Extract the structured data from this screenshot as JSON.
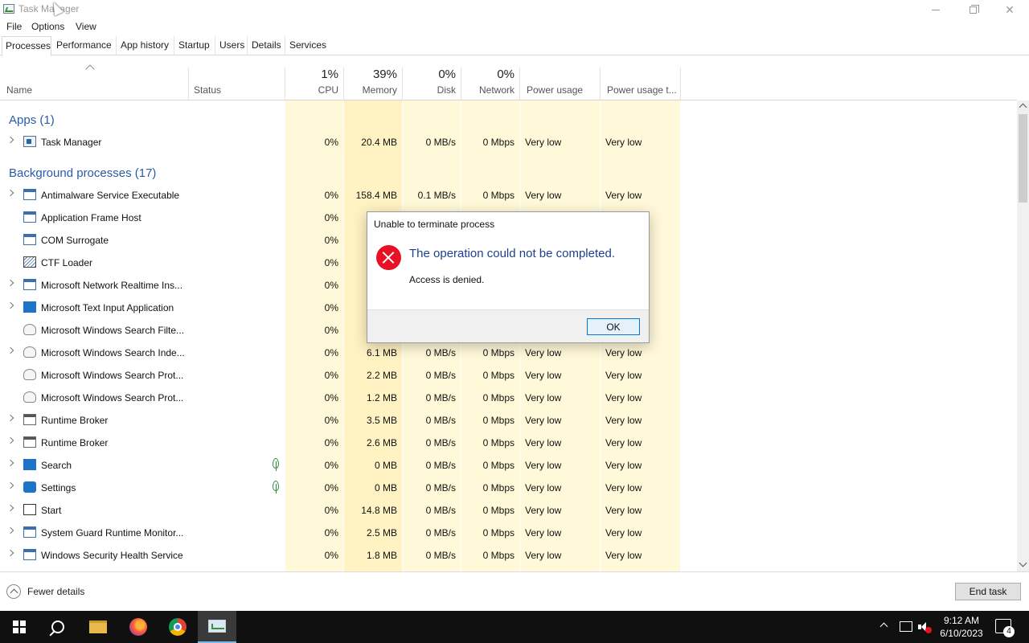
{
  "window": {
    "title": "Task Manager"
  },
  "menu": {
    "file": "File",
    "options": "Options",
    "view": "View"
  },
  "tabs": [
    "Processes",
    "Performance",
    "App history",
    "Startup",
    "Users",
    "Details",
    "Services"
  ],
  "columns": {
    "name": "Name",
    "status": "Status",
    "cpu": {
      "pct": "1%",
      "label": "CPU"
    },
    "memory": {
      "pct": "39%",
      "label": "Memory"
    },
    "disk": {
      "pct": "0%",
      "label": "Disk"
    },
    "network": {
      "pct": "0%",
      "label": "Network"
    },
    "power": "Power usage",
    "power_trend": "Power usage t..."
  },
  "groups": {
    "apps": "Apps (1)",
    "background": "Background processes (17)"
  },
  "processes": [
    {
      "name": "Task Manager",
      "icon": "task-manager-icon",
      "cpu": "0%",
      "mem": "20.4 MB",
      "disk": "0 MB/s",
      "net": "0 Mbps",
      "power": "Very low",
      "trend": "Very low"
    },
    {
      "name": "Antimalware Service Executable",
      "icon": "app-window-icon",
      "cpu": "0%",
      "mem": "158.4 MB",
      "disk": "0.1 MB/s",
      "net": "0 Mbps",
      "power": "Very low",
      "trend": "Very low"
    },
    {
      "name": "Application Frame Host",
      "icon": "app-window-icon",
      "cpu": "0%"
    },
    {
      "name": "COM Surrogate",
      "icon": "app-window-icon",
      "cpu": "0%"
    },
    {
      "name": "CTF Loader",
      "icon": "ctf-icon",
      "cpu": "0%"
    },
    {
      "name": "Microsoft Network Realtime Ins...",
      "icon": "app-window-icon",
      "cpu": "0%"
    },
    {
      "name": "Microsoft Text Input Application",
      "icon": "text-input-icon",
      "cpu": "0%"
    },
    {
      "name": "Microsoft Windows Search Filte...",
      "icon": "person-icon",
      "cpu": "0%"
    },
    {
      "name": "Microsoft Windows Search Inde...",
      "icon": "person-icon",
      "cpu": "0%",
      "mem": "6.1 MB",
      "disk": "0 MB/s",
      "net": "0 Mbps",
      "power": "Very low",
      "trend": "Very low"
    },
    {
      "name": "Microsoft Windows Search Prot...",
      "icon": "person-icon",
      "cpu": "0%",
      "mem": "2.2 MB",
      "disk": "0 MB/s",
      "net": "0 Mbps",
      "power": "Very low",
      "trend": "Very low"
    },
    {
      "name": "Microsoft Windows Search Prot...",
      "icon": "person-icon",
      "cpu": "0%",
      "mem": "1.2 MB",
      "disk": "0 MB/s",
      "net": "0 Mbps",
      "power": "Very low",
      "trend": "Very low"
    },
    {
      "name": "Runtime Broker",
      "icon": "gray-window-icon",
      "cpu": "0%",
      "mem": "3.5 MB",
      "disk": "0 MB/s",
      "net": "0 Mbps",
      "power": "Very low",
      "trend": "Very low"
    },
    {
      "name": "Runtime Broker",
      "icon": "gray-window-icon",
      "cpu": "0%",
      "mem": "2.6 MB",
      "disk": "0 MB/s",
      "net": "0 Mbps",
      "power": "Very low",
      "trend": "Very low"
    },
    {
      "name": "Search",
      "icon": "search-icon",
      "cpu": "0%",
      "mem": "0 MB",
      "disk": "0 MB/s",
      "net": "0 Mbps",
      "power": "Very low",
      "trend": "Very low"
    },
    {
      "name": "Settings",
      "icon": "gear-icon",
      "cpu": "0%",
      "mem": "0 MB",
      "disk": "0 MB/s",
      "net": "0 Mbps",
      "power": "Very low",
      "trend": "Very low"
    },
    {
      "name": "Start",
      "icon": "start-icon",
      "cpu": "0%",
      "mem": "14.8 MB",
      "disk": "0 MB/s",
      "net": "0 Mbps",
      "power": "Very low",
      "trend": "Very low"
    },
    {
      "name": "System Guard Runtime Monitor...",
      "icon": "app-window-icon",
      "cpu": "0%",
      "mem": "2.5 MB",
      "disk": "0 MB/s",
      "net": "0 Mbps",
      "power": "Very low",
      "trend": "Very low"
    },
    {
      "name": "Windows Security Health Service",
      "icon": "app-window-icon",
      "cpu": "0%",
      "mem": "1.8 MB",
      "disk": "0 MB/s",
      "net": "0 Mbps",
      "power": "Very low",
      "trend": "Very low"
    }
  ],
  "dialog": {
    "title": "Unable to terminate process",
    "main": "The operation could not be completed.",
    "sub": "Access is denied.",
    "ok": "OK"
  },
  "footer": {
    "fewer_details": "Fewer details",
    "end_task": "End task"
  },
  "taskbar": {
    "time": "9:12 AM",
    "date": "6/10/2023",
    "notifications": "4"
  },
  "colors": {
    "accent": "#2a5ba6",
    "cell_bg": "#fff9d9",
    "cell_bg_strong": "#fff1b8",
    "error": "#e81123"
  }
}
